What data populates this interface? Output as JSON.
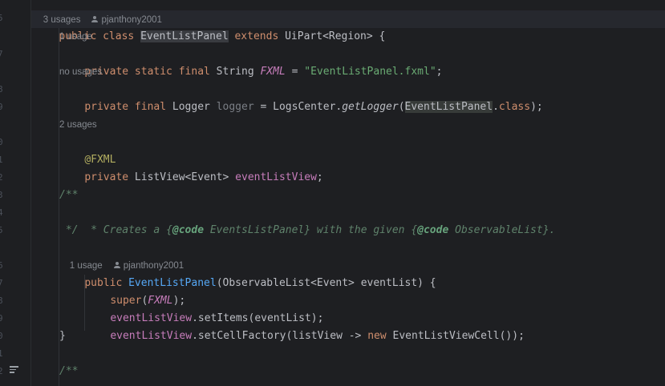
{
  "gutter": {
    "line_numbers": [
      "5",
      "7",
      "8",
      "9",
      "0",
      "1",
      "2",
      "3",
      "4",
      "5",
      "6",
      "7",
      "8",
      "9",
      "0",
      "1",
      "2"
    ]
  },
  "code": {
    "top_inlay": {
      "usages": "3 usages",
      "author": "pjanthony2001"
    },
    "class_decl": {
      "kw_public": "public",
      "kw_class": "class",
      "class_name": "EventListPanel",
      "kw_extends": "extends",
      "super_type": "UiPart<Region> {"
    },
    "inlay_1": "1 usage",
    "fxml_field": {
      "modifiers": "private static final",
      "type": " String ",
      "name": "FXML",
      "eq": " = ",
      "value": "\"EventListPanel.fxml\"",
      "end": ";"
    },
    "inlay_2": "no usages",
    "logger_field": {
      "modifiers": "private final",
      "type": " Logger ",
      "name": "logger",
      "eq": " = LogsCenter.",
      "method": "getLogger",
      "open": "(",
      "arg": "EventListPanel",
      "dot": ".",
      "kw_class": "class",
      "end": ");"
    },
    "inlay_3": "2 usages",
    "annotation": "@FXML",
    "listview_field": {
      "modifier": "private",
      "type": " ListView<Event> ",
      "name": "eventListView",
      "end": ";"
    },
    "javadoc": {
      "open": "/**",
      "star": " * Creates a ",
      "brace1": "{",
      "code_tag1": "@code",
      "ref1": " EventsListPanel}",
      "mid": " with the given ",
      "brace2": "{",
      "code_tag2": "@code",
      "ref2": " ObservableList}",
      "period": ".",
      "close": " */"
    },
    "ctor_inlay": {
      "usages": "1 usage",
      "author": "pjanthony2001"
    },
    "constructor": {
      "kw_public": "public",
      "name": "EventListPanel",
      "params": "(ObservableList<Event> eventList) {"
    },
    "super_call": {
      "kw": "super",
      "open": "(",
      "arg": "FXML",
      "close": ");"
    },
    "set_items": {
      "field": "eventListView",
      "rest": ".setItems(eventList);"
    },
    "set_factory": {
      "field": "eventListView",
      "rest1": ".setCellFactory(listView -> ",
      "kw_new": "new",
      "rest2": " EventListViewCell());"
    },
    "close_brace": "}",
    "javadoc2_open": "/**"
  }
}
